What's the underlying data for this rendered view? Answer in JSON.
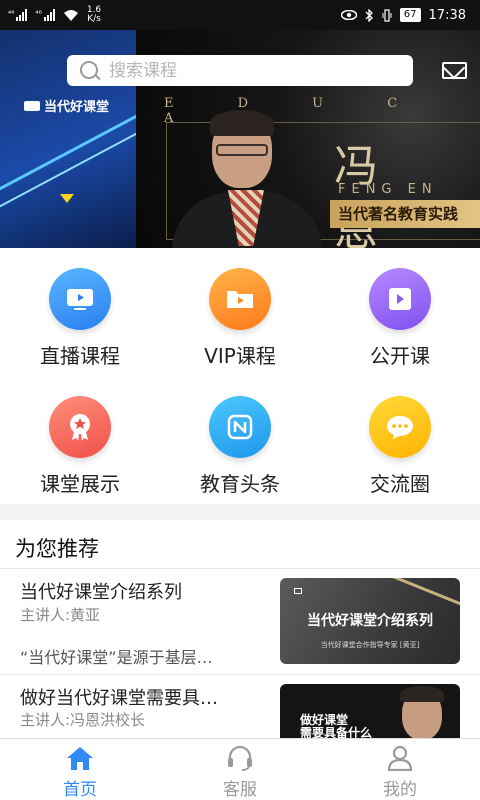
{
  "status_bar": {
    "sim1": "⁴⁶",
    "sim2": "⁴⁶",
    "speed_value": "1.6",
    "speed_unit": "K/s",
    "battery": "67",
    "time": "17:38"
  },
  "banner": {
    "logo_text": "当代好课堂",
    "educ_text": "E D U C A T",
    "name_text": "冯 恩",
    "pinyin_text": "FENG  EN",
    "slogan_text": "当代著名教育实践"
  },
  "search": {
    "placeholder": "搜索课程"
  },
  "menu": {
    "items": [
      {
        "label": "直播课程",
        "icon": "tv-icon"
      },
      {
        "label": "VIP课程",
        "icon": "folder-icon"
      },
      {
        "label": "公开课",
        "icon": "video-icon"
      },
      {
        "label": "课堂展示",
        "icon": "award-icon"
      },
      {
        "label": "教育头条",
        "icon": "news-icon"
      },
      {
        "label": "交流圈",
        "icon": "chat-icon"
      }
    ]
  },
  "recommend": {
    "title": "为您推荐",
    "cards": [
      {
        "title": "当代好课堂介绍系列",
        "author": "主讲人:黄亚",
        "desc": "“当代好课堂”是源于基层…",
        "thumb_title": "当代好课堂介绍系列",
        "thumb_sub": "当代好课堂合作指导专家 [黄亚]"
      },
      {
        "title": "做好当代好课堂需要具…",
        "author": "主讲人:冯恩洪校长",
        "thumb_title": "做好课堂\n需要具备什么"
      }
    ]
  },
  "tabs": [
    {
      "label": "首页",
      "icon": "home-icon",
      "active": true
    },
    {
      "label": "客服",
      "icon": "headset-icon",
      "active": false
    },
    {
      "label": "我的",
      "icon": "user-icon",
      "active": false
    }
  ],
  "colors": {
    "accent": "#2f8af5",
    "tab_inactive": "#9a9a9a"
  }
}
